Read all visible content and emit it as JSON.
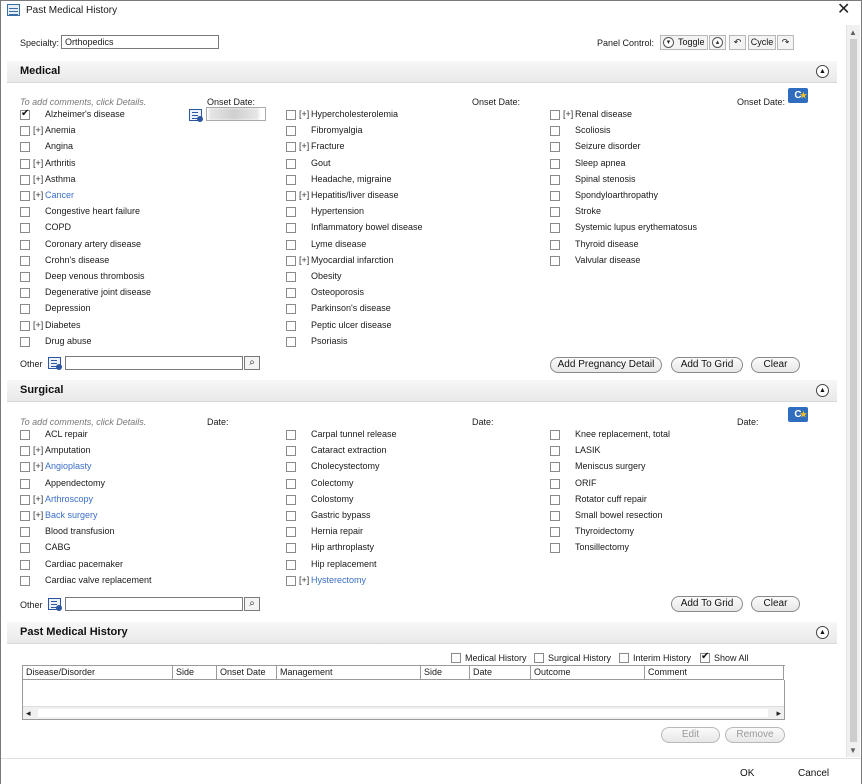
{
  "window": {
    "title": "Past Medical History",
    "close_symbol": "✕"
  },
  "top": {
    "specialty_label": "Specialty:",
    "specialty_value": "Orthopedics",
    "panel_control_label": "Panel Control:",
    "toggle_label": "Toggle",
    "cycle_label": "Cycle"
  },
  "medical": {
    "header": "Medical",
    "hint": "To add comments, click Details.",
    "onset_label": "Onset Date:",
    "columns": [
      [
        {
          "label": "Alzheimer's disease",
          "plus": "",
          "checked": true,
          "link": false
        },
        {
          "label": "Anemia",
          "plus": "[+]",
          "checked": false,
          "link": false
        },
        {
          "label": "Angina",
          "plus": "",
          "checked": false,
          "link": false
        },
        {
          "label": "Arthritis",
          "plus": "[+]",
          "checked": false,
          "link": false
        },
        {
          "label": "Asthma",
          "plus": "[+]",
          "checked": false,
          "link": false
        },
        {
          "label": "Cancer",
          "plus": "[+]",
          "checked": false,
          "link": true
        },
        {
          "label": "Congestive heart failure",
          "plus": "",
          "checked": false,
          "link": false
        },
        {
          "label": "COPD",
          "plus": "",
          "checked": false,
          "link": false
        },
        {
          "label": "Coronary artery disease",
          "plus": "",
          "checked": false,
          "link": false
        },
        {
          "label": "Crohn's disease",
          "plus": "",
          "checked": false,
          "link": false
        },
        {
          "label": "Deep venous thrombosis",
          "plus": "",
          "checked": false,
          "link": false
        },
        {
          "label": "Degenerative joint disease",
          "plus": "",
          "checked": false,
          "link": false
        },
        {
          "label": "Depression",
          "plus": "",
          "checked": false,
          "link": false
        },
        {
          "label": "Diabetes",
          "plus": "[+]",
          "checked": false,
          "link": false
        },
        {
          "label": "Drug abuse",
          "plus": "",
          "checked": false,
          "link": false
        }
      ],
      [
        {
          "label": "Hypercholesterolemia",
          "plus": "[+]",
          "checked": false,
          "link": false
        },
        {
          "label": "Fibromyalgia",
          "plus": "",
          "checked": false,
          "link": false
        },
        {
          "label": "Fracture",
          "plus": "[+]",
          "checked": false,
          "link": false
        },
        {
          "label": "Gout",
          "plus": "",
          "checked": false,
          "link": false
        },
        {
          "label": "Headache, migraine",
          "plus": "",
          "checked": false,
          "link": false
        },
        {
          "label": "Hepatitis/liver disease",
          "plus": "[+]",
          "checked": false,
          "link": false
        },
        {
          "label": "Hypertension",
          "plus": "",
          "checked": false,
          "link": false
        },
        {
          "label": "Inflammatory bowel disease",
          "plus": "",
          "checked": false,
          "link": false
        },
        {
          "label": "Lyme disease",
          "plus": "",
          "checked": false,
          "link": false
        },
        {
          "label": "Myocardial infarction",
          "plus": "[+]",
          "checked": false,
          "link": false
        },
        {
          "label": "Obesity",
          "plus": "",
          "checked": false,
          "link": false
        },
        {
          "label": "Osteoporosis",
          "plus": "",
          "checked": false,
          "link": false
        },
        {
          "label": "Parkinson's disease",
          "plus": "",
          "checked": false,
          "link": false
        },
        {
          "label": "Peptic ulcer disease",
          "plus": "",
          "checked": false,
          "link": false
        },
        {
          "label": "Psoriasis",
          "plus": "",
          "checked": false,
          "link": false
        }
      ],
      [
        {
          "label": "Renal disease",
          "plus": "[+]",
          "checked": false,
          "link": false
        },
        {
          "label": "Scoliosis",
          "plus": "",
          "checked": false,
          "link": false
        },
        {
          "label": "Seizure disorder",
          "plus": "",
          "checked": false,
          "link": false
        },
        {
          "label": "Sleep apnea",
          "plus": "",
          "checked": false,
          "link": false
        },
        {
          "label": "Spinal stenosis",
          "plus": "",
          "checked": false,
          "link": false
        },
        {
          "label": "Spondyloarthropathy",
          "plus": "",
          "checked": false,
          "link": false
        },
        {
          "label": "Stroke",
          "plus": "",
          "checked": false,
          "link": false
        },
        {
          "label": "Systemic lupus erythematosus",
          "plus": "",
          "checked": false,
          "link": false
        },
        {
          "label": "Thyroid disease",
          "plus": "",
          "checked": false,
          "link": false
        },
        {
          "label": "Valvular disease",
          "plus": "",
          "checked": false,
          "link": false
        }
      ]
    ],
    "other_label": "Other",
    "buttons": {
      "pregnancy": "Add Pregnancy Detail",
      "add_grid": "Add To Grid",
      "clear": "Clear"
    }
  },
  "surgical": {
    "header": "Surgical",
    "hint": "To add comments, click Details.",
    "date_label": "Date:",
    "columns": [
      [
        {
          "label": "ACL repair",
          "plus": "",
          "checked": false,
          "link": false
        },
        {
          "label": "Amputation",
          "plus": "[+]",
          "checked": false,
          "link": false
        },
        {
          "label": "Angioplasty",
          "plus": "[+]",
          "checked": false,
          "link": true
        },
        {
          "label": "Appendectomy",
          "plus": "",
          "checked": false,
          "link": false
        },
        {
          "label": "Arthroscopy",
          "plus": "[+]",
          "checked": false,
          "link": true
        },
        {
          "label": "Back surgery",
          "plus": "[+]",
          "checked": false,
          "link": true
        },
        {
          "label": "Blood transfusion",
          "plus": "",
          "checked": false,
          "link": false
        },
        {
          "label": "CABG",
          "plus": "",
          "checked": false,
          "link": false
        },
        {
          "label": "Cardiac pacemaker",
          "plus": "",
          "checked": false,
          "link": false
        },
        {
          "label": "Cardiac valve replacement",
          "plus": "",
          "checked": false,
          "link": false
        }
      ],
      [
        {
          "label": "Carpal tunnel release",
          "plus": "",
          "checked": false,
          "link": false
        },
        {
          "label": "Cataract extraction",
          "plus": "",
          "checked": false,
          "link": false
        },
        {
          "label": "Cholecystectomy",
          "plus": "",
          "checked": false,
          "link": false
        },
        {
          "label": "Colectomy",
          "plus": "",
          "checked": false,
          "link": false
        },
        {
          "label": "Colostomy",
          "plus": "",
          "checked": false,
          "link": false
        },
        {
          "label": "Gastric bypass",
          "plus": "",
          "checked": false,
          "link": false
        },
        {
          "label": "Hernia repair",
          "plus": "",
          "checked": false,
          "link": false
        },
        {
          "label": "Hip arthroplasty",
          "plus": "",
          "checked": false,
          "link": false
        },
        {
          "label": "Hip replacement",
          "plus": "",
          "checked": false,
          "link": false
        },
        {
          "label": "Hysterectomy",
          "plus": "[+]",
          "checked": false,
          "link": true
        }
      ],
      [
        {
          "label": "Knee replacement, total",
          "plus": "",
          "checked": false,
          "link": false
        },
        {
          "label": "LASIK",
          "plus": "",
          "checked": false,
          "link": false
        },
        {
          "label": "Meniscus surgery",
          "plus": "",
          "checked": false,
          "link": false
        },
        {
          "label": "ORIF",
          "plus": "",
          "checked": false,
          "link": false
        },
        {
          "label": "Rotator cuff repair",
          "plus": "",
          "checked": false,
          "link": false
        },
        {
          "label": "Small bowel resection",
          "plus": "",
          "checked": false,
          "link": false
        },
        {
          "label": "Thyroidectomy",
          "plus": "",
          "checked": false,
          "link": false
        },
        {
          "label": "Tonsillectomy",
          "plus": "",
          "checked": false,
          "link": false
        }
      ]
    ],
    "other_label": "Other",
    "buttons": {
      "add_grid": "Add To Grid",
      "clear": "Clear"
    }
  },
  "pmh": {
    "header": "Past Medical History",
    "filters": [
      {
        "label": "Medical History",
        "checked": false
      },
      {
        "label": "Surgical History",
        "checked": false
      },
      {
        "label": "Interim History",
        "checked": false
      },
      {
        "label": "Show All",
        "checked": true
      }
    ],
    "grid_headers": [
      "Disease/Disorder",
      "Side",
      "Onset Date",
      "Management",
      "Side",
      "Date",
      "Outcome",
      "Comment"
    ],
    "buttons": {
      "edit": "Edit",
      "remove": "Remove"
    }
  },
  "footer": {
    "ok": "OK",
    "cancel": "Cancel"
  },
  "colors": {
    "link": "#3a6fc8",
    "icon_blue": "#2f6dbf"
  }
}
